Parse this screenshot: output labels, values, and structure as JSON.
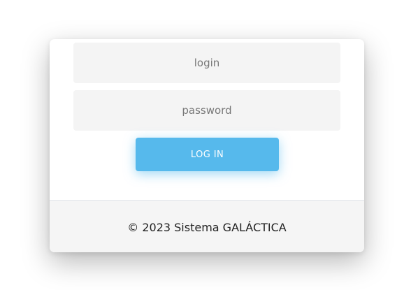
{
  "form": {
    "login_placeholder": "login",
    "login_value": "",
    "password_placeholder": "password",
    "password_value": "",
    "submit_label": "LOG IN"
  },
  "footer": {
    "copyright": "© 2023 Sistema GALÁCTICA"
  },
  "colors": {
    "accent": "#56b9ec",
    "field_background": "#f4f4f4",
    "footer_background": "#f5f5f5"
  }
}
